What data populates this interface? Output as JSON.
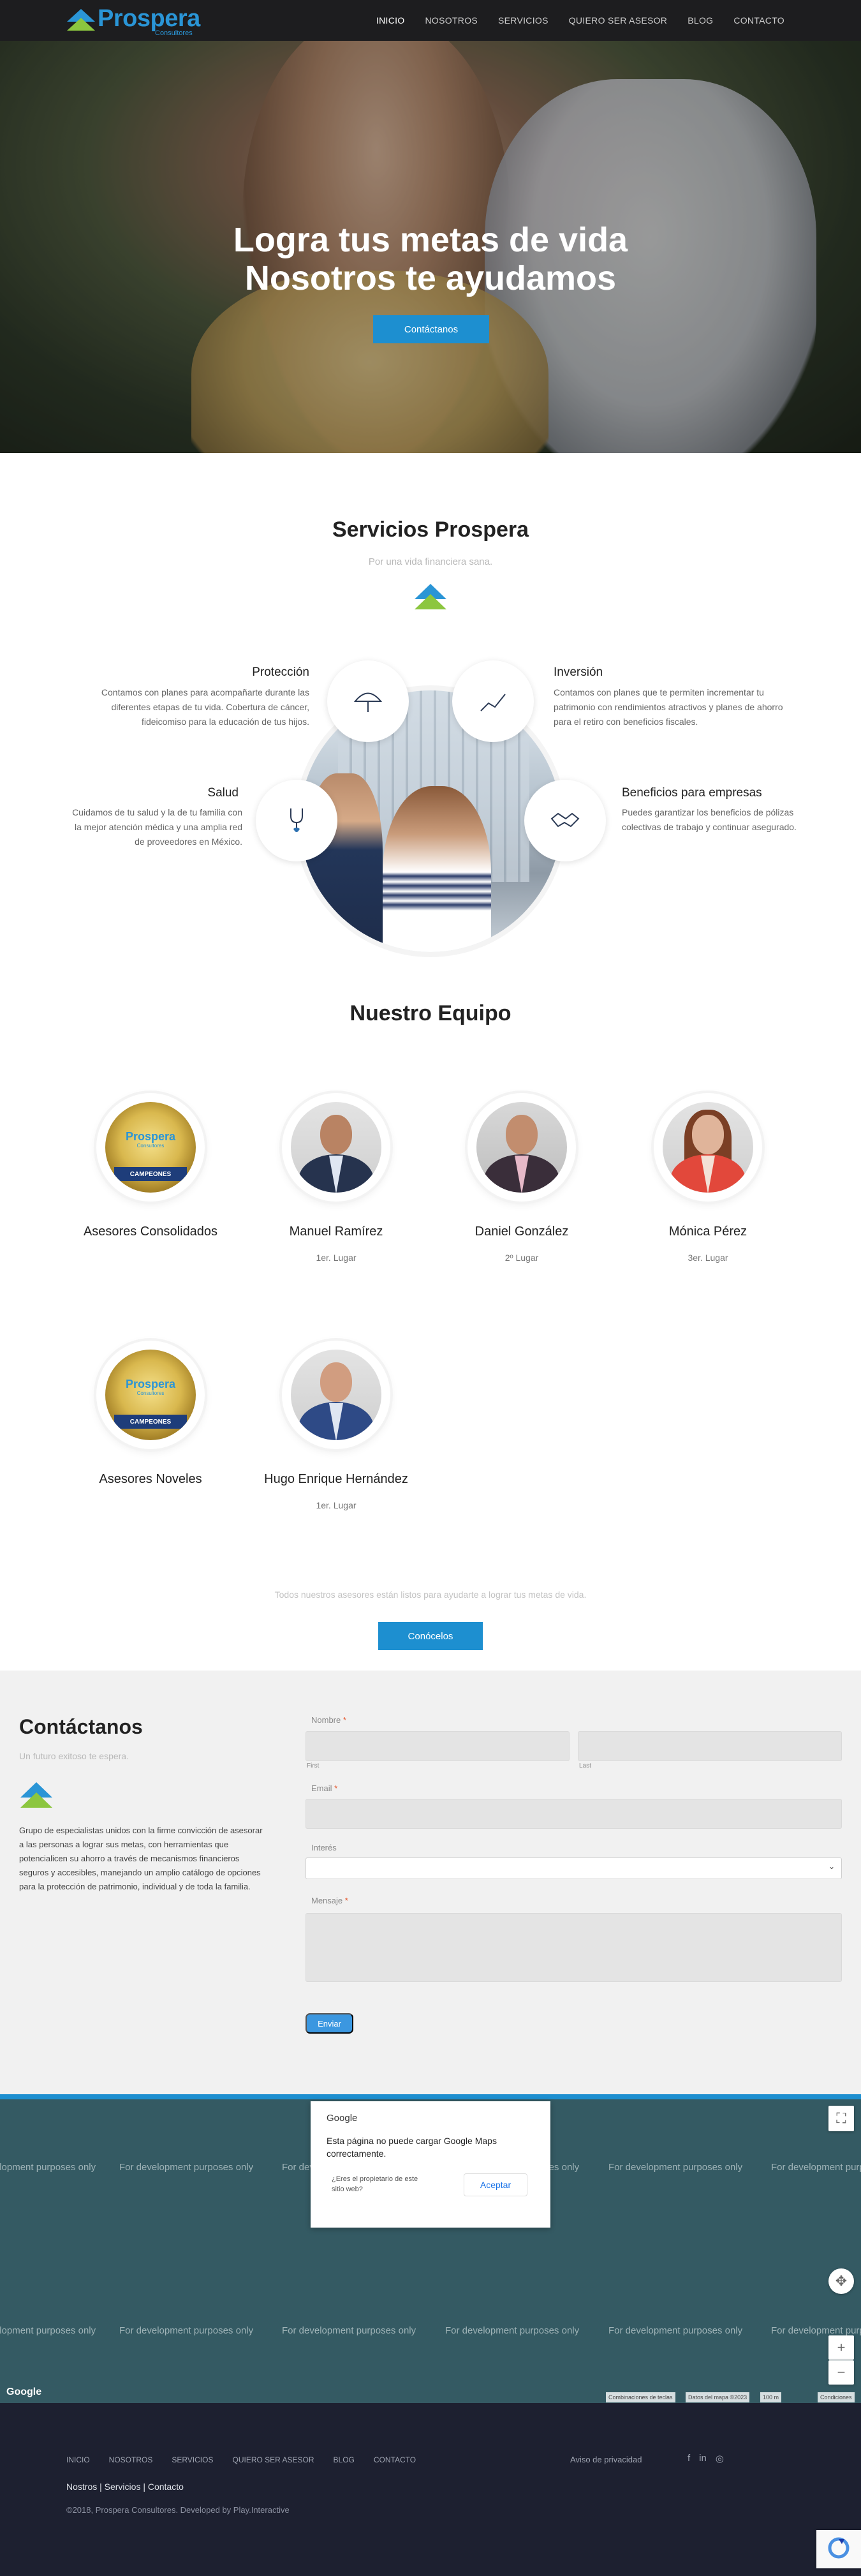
{
  "header": {
    "logo_word": "Prospera",
    "logo_sub": "Consultores",
    "menu": [
      "INICIO",
      "NOSOTROS",
      "SERVICIOS",
      "QUIERO SER ASESOR",
      "BLOG",
      "CONTACTO"
    ],
    "active": "INICIO"
  },
  "hero": {
    "line1": "Logra tus metas de vida",
    "line2": "Nosotros te ayudamos",
    "cta": "Contáctanos"
  },
  "services": {
    "title": "Servicios Prospera",
    "subtitle": "Por una vida financiera sana.",
    "items": [
      {
        "title": "Protección",
        "text": "Contamos con planes para acompañarte durante las diferentes etapas de tu vida. Cobertura de cáncer, fideicomiso para la educación de tus hijos.",
        "icon": "umbrella-icon"
      },
      {
        "title": "Inversión",
        "text": "Contamos con planes que te permiten incrementar tu patrimonio con rendimientos atractivos y planes de ahorro para el retiro con beneficios fiscales.",
        "icon": "chart-icon"
      },
      {
        "title": "Salud",
        "text": "Cuidamos de tu salud y la de tu familia con la mejor atención médica y una amplia red de proveedores en México.",
        "icon": "stethoscope-icon"
      },
      {
        "title": "Beneficios para empresas",
        "text": "Puedes garantizar los beneficios de pólizas colectivas de trabajo y continuar asegurado.",
        "icon": "handshake-icon"
      }
    ]
  },
  "team": {
    "title": "Nuestro Equipo",
    "members": [
      {
        "name": "Asesores Consolidados",
        "place": "",
        "type": "medal"
      },
      {
        "name": "Manuel Ramírez",
        "place": "1er. Lugar",
        "type": "man"
      },
      {
        "name": "Daniel González",
        "place": "2º Lugar",
        "type": "man"
      },
      {
        "name": "Mónica Pérez",
        "place": "3er. Lugar",
        "type": "woman"
      },
      {
        "name": "Asesores Noveles",
        "place": "",
        "type": "medal"
      },
      {
        "name": "Hugo Enrique Hernández",
        "place": "1er. Lugar",
        "type": "man"
      }
    ],
    "medal_word": "Prospera",
    "medal_sub": "Consultores",
    "medal_band": "CAMPEONES",
    "note": "Todos nuestros asesores están listos para ayudarte a lograr tus metas de vida.",
    "button": "Conócelos"
  },
  "contact": {
    "title": "Contáctanos",
    "subtitle": "Un futuro exitoso te espera.",
    "text": "Grupo de especialistas unidos con la firme convicción de asesorar a las personas a lograr sus metas, con herramientas que potencialicen su ahorro a través de mecanismos financieros seguros y accesibles, manejando un amplio catálogo de opciones para la protección de patrimonio, individual y de toda la familia.",
    "form": {
      "name_label": "Nombre",
      "first": "First",
      "last": "Last",
      "email_label": "Email",
      "interest_label": "Interés",
      "message_label": "Mensaje",
      "required": "*",
      "submit": "Enviar"
    }
  },
  "map": {
    "dev_text": "For development purposes only",
    "dialog_brand": "Google",
    "dialog_title": "Esta página no puede cargar Google Maps correctamente.",
    "dialog_question": "¿Eres el propietario de este sitio web?",
    "dialog_ok": "Aceptar",
    "google": "Google",
    "attr1": "Combinaciones de teclas",
    "attr2": "Datos del mapa ©2023",
    "attr3": "100 m",
    "attr4": "Condiciones"
  },
  "footer": {
    "menu": [
      "INICIO",
      "NOSOTROS",
      "SERVICIOS",
      "QUIERO SER ASESOR",
      "BLOG",
      "CONTACTO"
    ],
    "privacy": "Aviso de privacidad",
    "links": "Nostros | Servicios | Contacto",
    "copy": "©2018, Prospera Consultores. Developed by Play.Interactive"
  },
  "colors": {
    "brand": "#1d8fd0",
    "nav": "#1d1d1f",
    "footer": "#1d2030",
    "map": "#345a63"
  }
}
